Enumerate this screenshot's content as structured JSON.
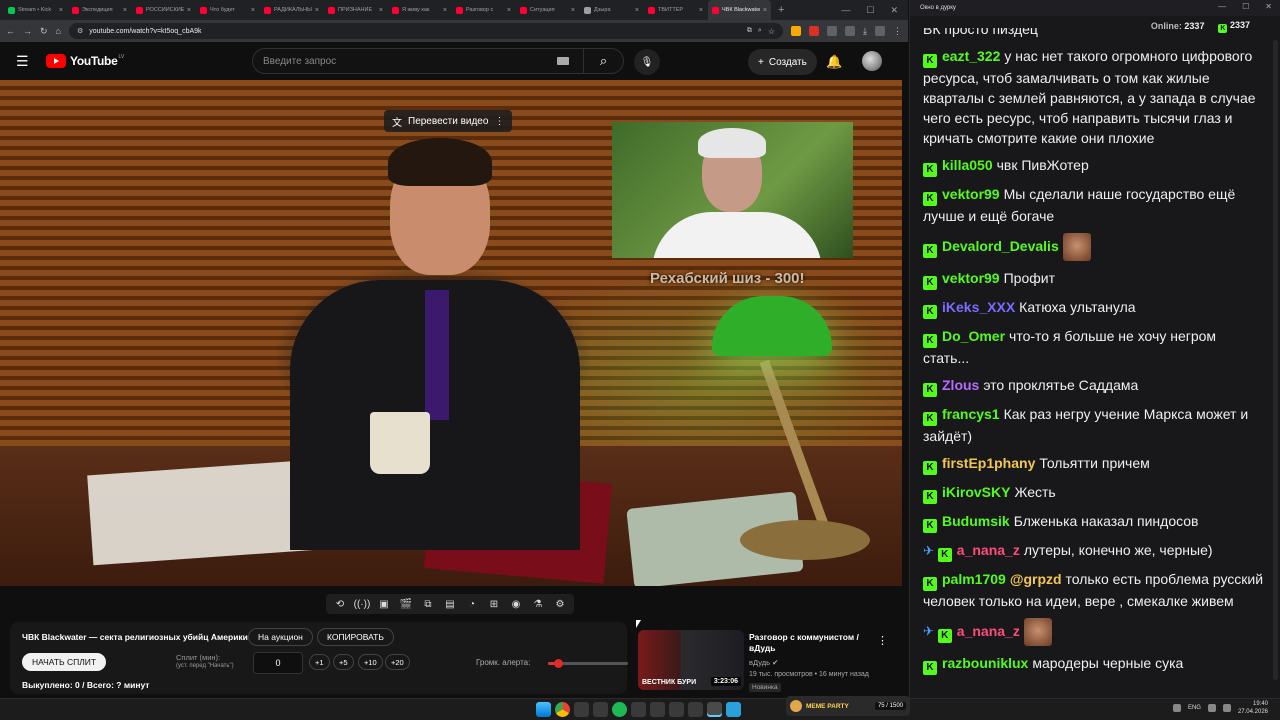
{
  "browser": {
    "tabs": [
      {
        "title": "Stream • Kick",
        "fav": "green"
      },
      {
        "title": "Экспедиция",
        "fav": "red"
      },
      {
        "title": "РОССИЙСКИЕ",
        "fav": "red"
      },
      {
        "title": "Что будет",
        "fav": "red"
      },
      {
        "title": "РАДИКАЛЬНЫЕ",
        "fav": "red"
      },
      {
        "title": "ПРИЗНАНИЕ",
        "fav": "red"
      },
      {
        "title": "Я живу как",
        "fav": "red"
      },
      {
        "title": "Разговор с",
        "fav": "red"
      },
      {
        "title": "Ситуация",
        "fav": "red"
      },
      {
        "title": "Дзыра",
        "fav": "gray"
      },
      {
        "title": "ТВИТТЕР",
        "fav": "red"
      },
      {
        "title": "ЧВК Blackwater",
        "fav": "red",
        "active": true
      }
    ],
    "url": "youtube.com/watch?v=kt5oq_cbA9k"
  },
  "youtube": {
    "logo_text": "YouTube",
    "country": "LV",
    "search_placeholder": "Введите запрос",
    "create_label": "Создать",
    "translate_label": "Перевести видео",
    "video_caption": "Рехабский шиз - 300!"
  },
  "panel": {
    "title": "ЧВК Blackwater — секта религиозных убийц Америки!",
    "auction_label": "На аукцион",
    "copy_label": "КОПИРОВАТЬ",
    "start_split_label": "НАЧАТЬ СПЛИТ",
    "split_label": "Сплит (мин):",
    "split_sub": "(уст. перед \"Начать\")",
    "split_value": "0",
    "increments": [
      "+1",
      "+5",
      "+10",
      "+20"
    ],
    "volume_label": "Громк. алерта:",
    "volume_level": 0.12,
    "bought": "Выкуплено: 0 / Всего: ? минут"
  },
  "recommended": {
    "thumb_text": "ВЕСТНИК БУРИ",
    "duration": "3:23:06",
    "title": "Разговор с коммунистом / вДудь",
    "channel": "вДудь",
    "meta": "19 тыс. просмотров • 16 минут назад",
    "badge": "Новинка"
  },
  "chat": {
    "window_title": "Окно в дурку",
    "online_label": "Online:",
    "online_count": "2337",
    "kick_count": "2337",
    "first_line": "ВК просто пиздец",
    "messages": [
      {
        "user": "eazt_322",
        "color": "#53fc18",
        "text": "у нас нет такого огромного цифрового ресурса, чтоб замалчивать о том как жилые кварталы с землей равняются, а у запада в случае чего есть ресурс, чтоб направить тысячи глаз и кричать смотрите какие они плохие"
      },
      {
        "user": "killa050",
        "color": "#53fc18",
        "text": "чвк ПивЖотер"
      },
      {
        "user": "vektor99",
        "color": "#53fc18",
        "text": "Мы сделали наше государство ещё лучше и ещё богаче"
      },
      {
        "user": "Devalord_Devalis",
        "color": "#53fc18",
        "text": "",
        "emote": true
      },
      {
        "user": "vektor99",
        "color": "#53fc18",
        "text": "Профит"
      },
      {
        "user": "iKeks_XXX",
        "color": "#7b6cff",
        "text": "Катюха ультанула"
      },
      {
        "user": "Do_Omer",
        "color": "#53fc18",
        "text": "что-то я больше не хочу негром стать..."
      },
      {
        "user": "Zlous",
        "color": "#b86bff",
        "text": "это проклятье Саддама"
      },
      {
        "user": "francys1",
        "color": "#53fc18",
        "text": "Как раз негру учение Маркса может и зайдёт)"
      },
      {
        "user": "firstEp1phany",
        "color": "#f3c74a",
        "text": "Тольятти причем"
      },
      {
        "user": "iKirovSKY",
        "color": "#53fc18",
        "text": "Жесть"
      },
      {
        "user": "Budumsik",
        "color": "#53fc18",
        "text": "Блженька наказал пиндосов"
      },
      {
        "user": "a_nana_z",
        "color": "#ff4b7a",
        "text": "лутеры, конечно же, черные)",
        "pin": true
      },
      {
        "user": "palm1709",
        "color": "#53fc18",
        "text": "только есть проблема русский человек только на идеи, вере , смекалке живем",
        "mention": "@grpzd"
      },
      {
        "user": "a_nana_z",
        "color": "#ff4b7a",
        "text": "",
        "pin": true,
        "emote": true
      },
      {
        "user": "razbouniklux",
        "color": "#53fc18",
        "text": "мародеры черные сука"
      }
    ]
  },
  "taskbar": {
    "meme_label": "MEME PARTY",
    "meme_count": "75 / 1500",
    "lang": "ENG",
    "time": "19:40",
    "date": "27.04.2026"
  }
}
